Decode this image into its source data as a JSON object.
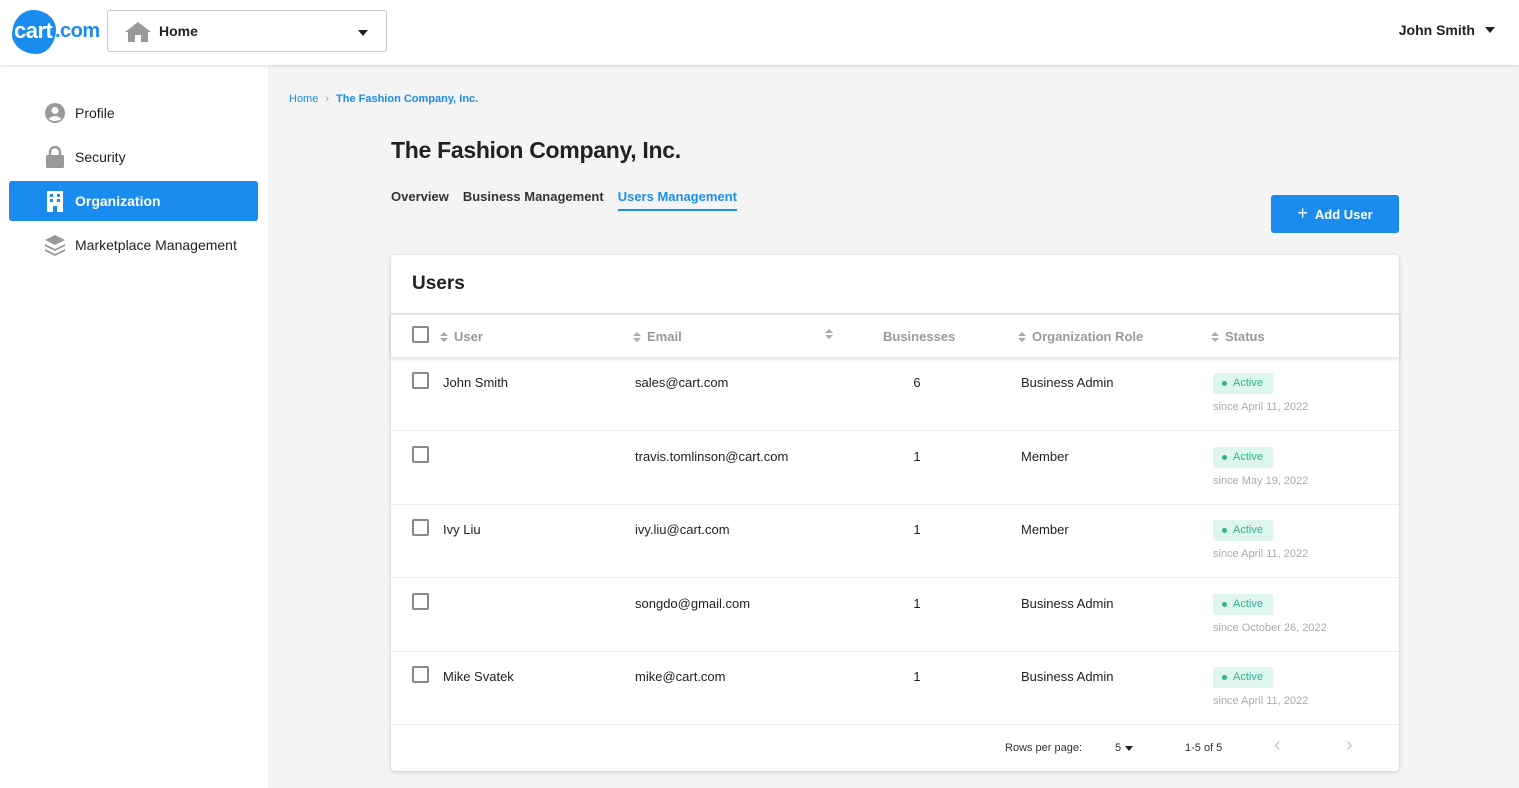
{
  "header": {
    "logo_main": "cart",
    "logo_suffix": ".com",
    "home_select_label": "Home",
    "user_name": "John Smith"
  },
  "sidebar": {
    "items": [
      {
        "label": "Profile",
        "icon": "person-circle-icon"
      },
      {
        "label": "Security",
        "icon": "lock-icon"
      },
      {
        "label": "Organization",
        "icon": "building-icon",
        "active": true
      },
      {
        "label": "Marketplace Management",
        "icon": "layers-icon"
      }
    ]
  },
  "breadcrumb": {
    "home": "Home",
    "separator": "›",
    "current": "The Fashion Company, Inc."
  },
  "page": {
    "title": "The Fashion Company, Inc.",
    "tabs": [
      "Overview",
      "Business Management",
      "Users Management"
    ],
    "active_tab": "Users Management",
    "add_user_label": "Add User"
  },
  "users_card": {
    "title": "Users",
    "columns": {
      "user": "User",
      "email": "Email",
      "businesses": "Businesses",
      "role": "Organization Role",
      "status": "Status"
    },
    "rows": [
      {
        "user": "John Smith",
        "email": "sales@cart.com",
        "businesses": "6",
        "role": "Business Admin",
        "status": "Active",
        "since": "since April 11, 2022"
      },
      {
        "user": "",
        "email": "travis.tomlinson@cart.com",
        "businesses": "1",
        "role": "Member",
        "status": "Active",
        "since": "since May 19, 2022"
      },
      {
        "user": "Ivy Liu",
        "email": "ivy.liu@cart.com",
        "businesses": "1",
        "role": "Member",
        "status": "Active",
        "since": "since April 11, 2022"
      },
      {
        "user": "",
        "email": "songdo@gmail.com",
        "businesses": "1",
        "role": "Business Admin",
        "status": "Active",
        "since": "since October 26, 2022"
      },
      {
        "user": "Mike Svatek",
        "email": "mike@cart.com",
        "businesses": "1",
        "role": "Business Admin",
        "status": "Active",
        "since": "since April 11, 2022"
      }
    ],
    "footer": {
      "rows_per_page_label": "Rows per page:",
      "rows_per_page_value": "5",
      "range": "1-5 of 5",
      "prev": "‹",
      "next": "›"
    }
  },
  "colors": {
    "accent": "#1a8cf0",
    "status_active_bg": "#dff6ef",
    "status_active_text": "#2ab48b"
  }
}
